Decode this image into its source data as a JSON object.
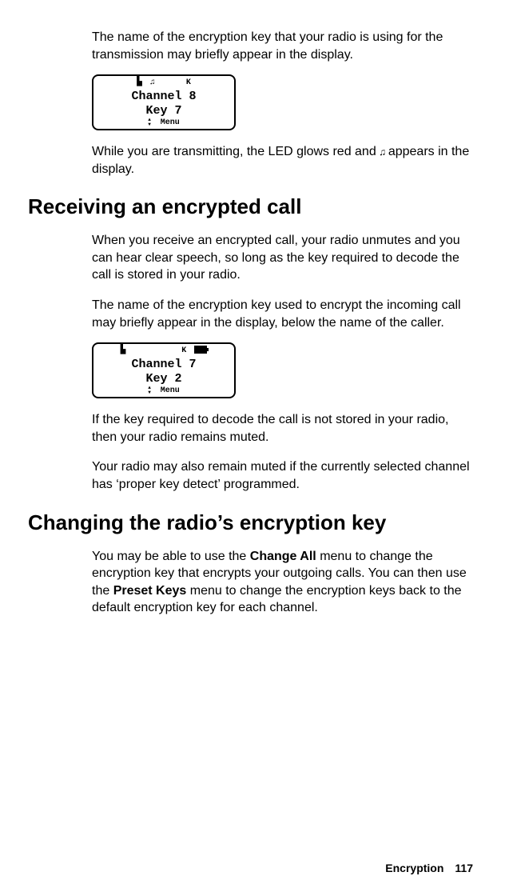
{
  "intro": {
    "p1": "The name of the encryption key that your radio is using for the transmission may briefly appear in the display."
  },
  "lcd1": {
    "channel": "Channel 8",
    "key": "Key 7",
    "menu": "Menu",
    "icons": {
      "signal": "▙",
      "tx": "♫",
      "k": "K"
    }
  },
  "intro2": {
    "pre": "While you are transmitting, the LED glows red and ",
    "tx_icon": "♫",
    "post": " appears in the display."
  },
  "section1": {
    "title": "Receiving an encrypted call",
    "p1": "When you receive an encrypted call, your radio unmutes and you can hear clear speech, so long as the key required to decode the call is stored in your radio.",
    "p2": "The name of the encryption key used to encrypt the incoming call may briefly appear in the display, below the name of the caller."
  },
  "lcd2": {
    "channel": "Channel 7",
    "key": "Key 2",
    "menu": "Menu",
    "icons": {
      "signal": "▙",
      "k": "K"
    }
  },
  "section1b": {
    "p3": "If the key required to decode the call is not stored in your radio, then your radio remains muted.",
    "p4": "Your radio may also remain muted if the currently selected channel has ‘proper key detect’ programmed."
  },
  "section2": {
    "title": "Changing the radio’s encryption key",
    "p1a": "You may be able to use the ",
    "bold1": "Change All",
    "p1b": " menu to change the encryption key that encrypts your outgoing calls. You can then use the ",
    "bold2": "Preset Keys",
    "p1c": " menu to change the encryption keys back to the default encryption key for each channel."
  },
  "footer": {
    "label": "Encryption",
    "page": "117"
  }
}
